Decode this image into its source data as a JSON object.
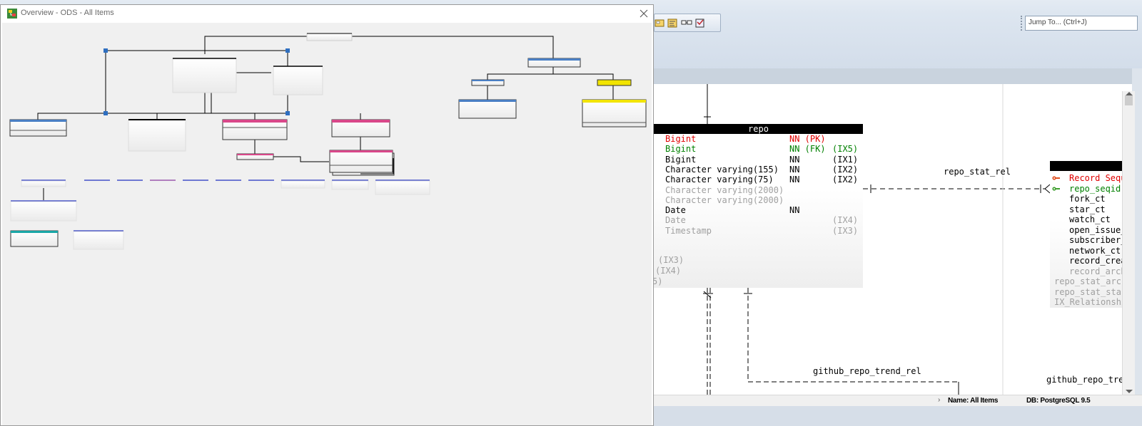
{
  "overview": {
    "title": "Overview - ODS - All Items"
  },
  "toolbar": {
    "icons": [
      "layout-icon",
      "layout-alt-icon",
      "relationship-icon",
      "properties-icon"
    ],
    "jump_to_placeholder": "Jump To... (Ctrl+J)"
  },
  "repo_table": {
    "name": "repo",
    "rows": [
      {
        "type": "Bigint",
        "nn": "NN",
        "key": "(PK)",
        "idx": "",
        "color": "#e00000"
      },
      {
        "type": "Bigint",
        "nn": "NN",
        "key": "(FK)",
        "idx": "(IX5)",
        "color": "#008000"
      },
      {
        "type": "Bigint",
        "nn": "NN",
        "key": "",
        "idx": "(IX1)",
        "color": "#000000"
      },
      {
        "type": "Character varying(155)",
        "nn": "NN",
        "key": "",
        "idx": "(IX2)",
        "color": "#000000"
      },
      {
        "type": "Character varying(75)",
        "nn": "NN",
        "key": "",
        "idx": "(IX2)",
        "color": "#000000"
      },
      {
        "type": "Character varying(2000)",
        "nn": "",
        "key": "",
        "idx": "",
        "color": "#a0a0a0"
      },
      {
        "type": "Character varying(2000)",
        "nn": "",
        "key": "",
        "idx": "",
        "color": "#a0a0a0"
      },
      {
        "type": "Date",
        "nn": "NN",
        "key": "",
        "idx": "",
        "color": "#000000"
      },
      {
        "type": "Date",
        "nn": "",
        "key": "",
        "idx": "(IX4)",
        "color": "#a0a0a0"
      },
      {
        "type": "Timestamp",
        "nn": "",
        "key": "",
        "idx": "(IX3)",
        "color": "#a0a0a0"
      }
    ],
    "index_refs": [
      "(IX3)",
      "(IX4)",
      "5)"
    ]
  },
  "stat_table": {
    "rows": [
      {
        "text": "Record Seque",
        "color": "#e00000",
        "icon": "primary-key-icon"
      },
      {
        "text": "repo_seqid",
        "color": "#008000",
        "icon": "foreign-key-icon"
      },
      {
        "text": "fork_ct",
        "color": "#000000",
        "icon": ""
      },
      {
        "text": "star_ct",
        "color": "#000000",
        "icon": ""
      },
      {
        "text": "watch_ct",
        "color": "#000000",
        "icon": ""
      },
      {
        "text": "open_issue_c",
        "color": "#000000",
        "icon": ""
      },
      {
        "text": "subscriber_c",
        "color": "#000000",
        "icon": ""
      },
      {
        "text": "network_ct",
        "color": "#000000",
        "icon": ""
      },
      {
        "text": "record_creat",
        "color": "#000000",
        "icon": ""
      },
      {
        "text": "record_archi",
        "color": "#a0a0a0",
        "icon": ""
      }
    ],
    "relationships": [
      "repo_stat_archi",
      "repo_stat_star",
      "IX_Relationshi"
    ]
  },
  "relationship_labels": {
    "stat_rel": "repo_stat_rel",
    "trend_rel": "github_repo_trend_rel",
    "trend_rel_cut": "github_repo_tren"
  },
  "status_bar": {
    "name_label": "Name: All Items",
    "db_label": "DB: PostgreSQL 9.5"
  },
  "colors": {
    "pink": "#d9488a",
    "blue": "#4a7fc4",
    "yellow": "#f2e400",
    "teal": "#1aa7a7",
    "navy": "#2030c0",
    "selection": "#2f6fc0"
  }
}
